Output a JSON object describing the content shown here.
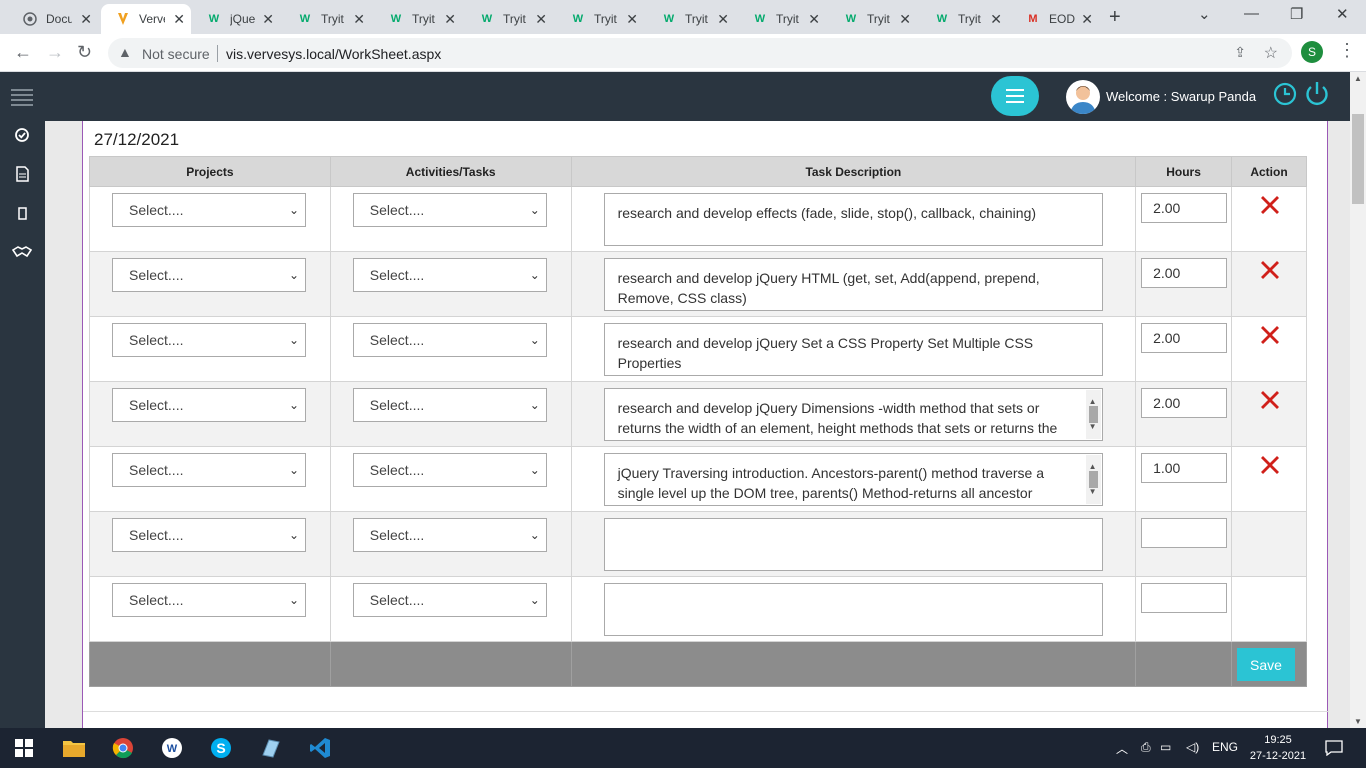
{
  "browser": {
    "tabs": [
      {
        "title": "Docu",
        "icon": "globe-icon",
        "active": false
      },
      {
        "title": "Verve",
        "icon": "verve-icon",
        "active": true
      },
      {
        "title": "jQue",
        "icon": "w3schools-icon",
        "active": false
      },
      {
        "title": "Tryit",
        "icon": "w3schools-icon",
        "active": false
      },
      {
        "title": "Tryit",
        "icon": "w3schools-icon",
        "active": false
      },
      {
        "title": "Tryit",
        "icon": "w3schools-icon",
        "active": false
      },
      {
        "title": "Tryit",
        "icon": "w3schools-icon",
        "active": false
      },
      {
        "title": "Tryit",
        "icon": "w3schools-icon",
        "active": false
      },
      {
        "title": "Tryit",
        "icon": "w3schools-icon",
        "active": false
      },
      {
        "title": "Tryit",
        "icon": "w3schools-icon",
        "active": false
      },
      {
        "title": "Tryit",
        "icon": "w3schools-icon",
        "active": false
      },
      {
        "title": "EOD",
        "icon": "gmail-icon",
        "active": false
      }
    ],
    "security_label": "Not secure",
    "url": "vis.vervesys.local/WorkSheet.aspx",
    "profile_initial": "S"
  },
  "header": {
    "welcome": "Welcome : Swarup Panda"
  },
  "sidebar": {
    "icons": [
      "check-circle-icon",
      "document-icon",
      "mobile-icon",
      "handshake-icon"
    ]
  },
  "worksheet": {
    "date": "27/12/2021",
    "columns": [
      "Projects",
      "Activities/Tasks",
      "Task Description",
      "Hours",
      "Action"
    ],
    "select_placeholder": "Select....",
    "rows": [
      {
        "description": "research and develop effects (fade, slide, stop(), callback, chaining)",
        "hours": "2.00",
        "deletable": true
      },
      {
        "description": "research and develop jQuery HTML (get, set, Add(append, prepend, Remove, CSS class)",
        "hours": "2.00",
        "deletable": true
      },
      {
        "description": "research and develop jQuery Set a CSS Property Set Multiple CSS Properties",
        "hours": "2.00",
        "deletable": true
      },
      {
        "description": "research and develop jQuery Dimensions -width method that sets or returns the width of an element, height methods that sets or returns the height of an element",
        "hours": "2.00",
        "deletable": true
      },
      {
        "description": "jQuery Traversing introduction. Ancestors-parent() method traverse a single level up the DOM tree, parents() Method-returns all ancestor elements of the selected element, parentsUntil()",
        "hours": "1.00",
        "deletable": true
      },
      {
        "description": "",
        "hours": "",
        "deletable": false
      },
      {
        "description": "",
        "hours": "",
        "deletable": false
      }
    ],
    "save_label": "Save"
  },
  "taskbar": {
    "language": "ENG",
    "time": "19:25",
    "date": "27-12-2021"
  },
  "colors": {
    "accent": "#2bc4d4",
    "nav_bg": "#2a3540",
    "delete": "#d0201a"
  }
}
